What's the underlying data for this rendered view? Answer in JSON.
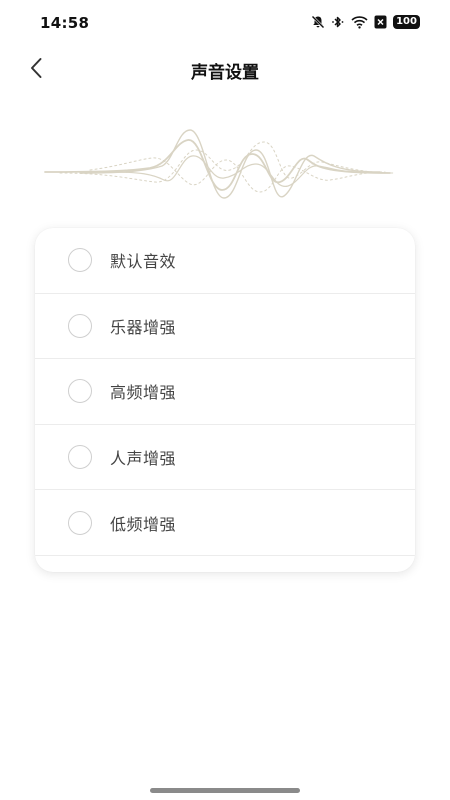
{
  "status_bar": {
    "time": "14:58",
    "icons": [
      "bell-muted-icon",
      "bluetooth-icon",
      "wifi-icon",
      "sim-blocked-icon",
      "battery-icon"
    ],
    "battery_level": "100"
  },
  "nav": {
    "back_icon": "chevron-left-icon",
    "title": "声音设置"
  },
  "sound_options": [
    {
      "label": "默认音效",
      "selected": false
    },
    {
      "label": "乐器增强",
      "selected": false
    },
    {
      "label": "高频增强",
      "selected": false
    },
    {
      "label": "人声增强",
      "selected": false
    },
    {
      "label": "低频增强",
      "selected": false
    }
  ],
  "colors": {
    "background": "#ffffff",
    "wave": "#d9d4c4",
    "radio_border": "#cfcfcf",
    "divider": "#ececec"
  }
}
